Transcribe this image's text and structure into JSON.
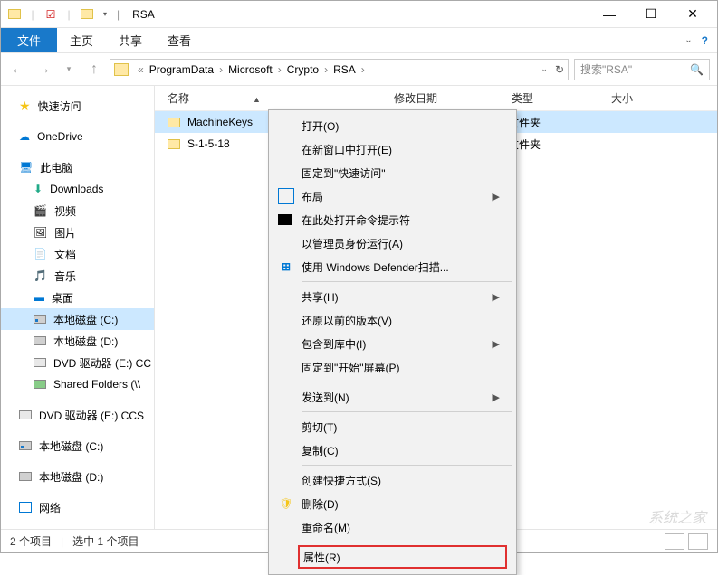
{
  "title": {
    "folder": "RSA"
  },
  "ribbon": {
    "file": "文件",
    "home": "主页",
    "share": "共享",
    "view": "查看"
  },
  "breadcrumb": {
    "parts": [
      "ProgramData",
      "Microsoft",
      "Crypto",
      "RSA"
    ]
  },
  "search": {
    "placeholder": "搜索\"RSA\""
  },
  "columns": {
    "name": "名称",
    "date": "修改日期",
    "type": "类型",
    "size": "大小"
  },
  "sidebar": {
    "quick": "快速访问",
    "onedrive": "OneDrive",
    "pc": "此电脑",
    "downloads": "Downloads",
    "video": "视频",
    "pictures": "图片",
    "documents": "文档",
    "music": "音乐",
    "desktop": "桌面",
    "disk_c": "本地磁盘 (C:)",
    "disk_d": "本地磁盘 (D:)",
    "dvd_e": "DVD 驱动器 (E:) CC",
    "shared": "Shared Folders (\\\\",
    "dvd_e2": "DVD 驱动器 (E:) CCS",
    "disk_c2": "本地磁盘 (C:)",
    "disk_d2": "本地磁盘 (D:)",
    "network": "网络"
  },
  "files": {
    "items": [
      {
        "name": "MachineKeys",
        "type": "文件夹"
      },
      {
        "name": "S-1-5-18",
        "type": "文件夹"
      }
    ]
  },
  "context_menu": {
    "open": "打开(O)",
    "open_new": "在新窗口中打开(E)",
    "pin_quick": "固定到\"快速访问\"",
    "layout": "布局",
    "cmd_here": "在此处打开命令提示符",
    "run_admin": "以管理员身份运行(A)",
    "defender": "使用 Windows Defender扫描...",
    "share": "共享(H)",
    "prev_versions": "还原以前的版本(V)",
    "include_lib": "包含到库中(I)",
    "pin_start": "固定到\"开始\"屏幕(P)",
    "send_to": "发送到(N)",
    "cut": "剪切(T)",
    "copy": "复制(C)",
    "shortcut": "创建快捷方式(S)",
    "delete": "删除(D)",
    "rename": "重命名(M)",
    "properties": "属性(R)"
  },
  "status": {
    "count": "2 个项目",
    "selected": "选中 1 个项目"
  },
  "watermark": "系统之家"
}
